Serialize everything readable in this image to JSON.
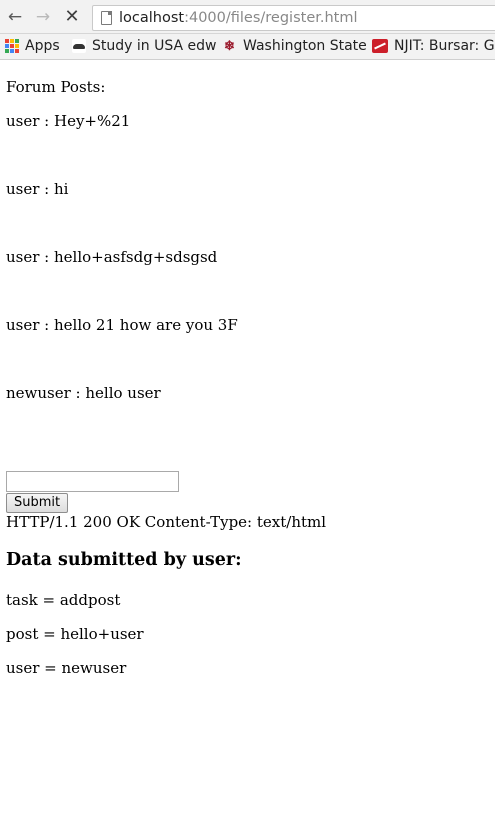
{
  "browser": {
    "url_host": "localhost",
    "url_path": ":4000/files/register.html"
  },
  "bookmarks": [
    {
      "label": "Apps",
      "icon": "apps-grid-icon"
    },
    {
      "label": "Study in USA edw",
      "icon": "study-favicon"
    },
    {
      "label": "Washington State",
      "icon": "wsu-favicon"
    },
    {
      "label": "NJIT: Bursar: Gra",
      "icon": "njit-favicon"
    }
  ],
  "page": {
    "forum_title": "Forum Posts:",
    "posts": [
      {
        "text": "user : Hey+%21"
      },
      {
        "text": "user : hi"
      },
      {
        "text": "user : hello+asfsdg+sdsgsd"
      },
      {
        "text": "user : hello 21 how are you 3F"
      },
      {
        "text": "newuser : hello user"
      }
    ],
    "post_input_value": "",
    "submit_label": "Submit",
    "http_status": "HTTP/1.1 200 OK Content-Type: text/html",
    "data_heading": "Data submitted by user:",
    "data_lines": [
      {
        "text": "task = addpost"
      },
      {
        "text": "post = hello+user"
      },
      {
        "text": "user = newuser"
      }
    ]
  }
}
